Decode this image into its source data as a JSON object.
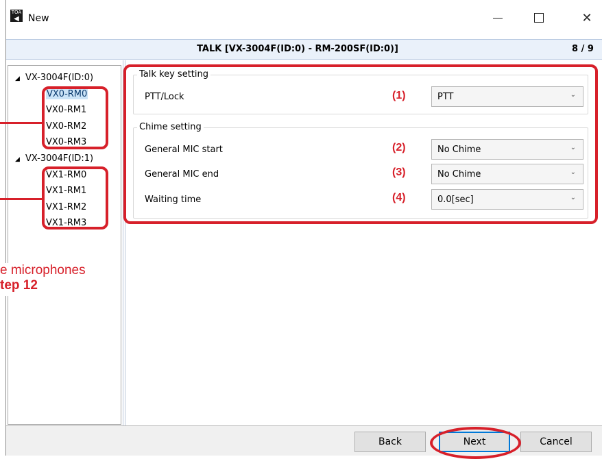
{
  "window": {
    "title": "New",
    "app_icon_text": "TOA",
    "close_glyph": "✕"
  },
  "header": {
    "title": "TALK [VX-3004F(ID:0) - RM-200SF(ID:0)]",
    "page": "8 / 9"
  },
  "tree": {
    "nodes": [
      {
        "label": "VX-3004F(ID:0)",
        "expanded": true,
        "children": [
          "VX0-RM0",
          "VX0-RM1",
          "VX0-RM2",
          "VX0-RM3"
        ]
      },
      {
        "label": "VX-3004F(ID:1)",
        "expanded": true,
        "children": [
          "VX1-RM0",
          "VX1-RM1",
          "VX1-RM2",
          "VX1-RM3"
        ]
      }
    ],
    "selected": "VX0-RM0",
    "toggle_glyph": "◢"
  },
  "talk_key": {
    "group_title": "Talk key setting",
    "rows": [
      {
        "label": "PTT/Lock",
        "num": "(1)",
        "value": "PTT"
      }
    ]
  },
  "chime": {
    "group_title": "Chime setting",
    "rows": [
      {
        "label": "General MIC start",
        "num": "(2)",
        "value": "No Chime"
      },
      {
        "label": "General MIC end",
        "num": "(3)",
        "value": "No Chime"
      },
      {
        "label": "Waiting time",
        "num": "(4)",
        "value": "0.0[sec]"
      }
    ]
  },
  "annotation": {
    "line1": "e  microphones",
    "line2": "tep 12",
    "color": "#d7202a"
  },
  "buttons": {
    "back": "Back",
    "next": "Next",
    "cancel": "Cancel"
  },
  "dropdown_arrow": "⌄"
}
